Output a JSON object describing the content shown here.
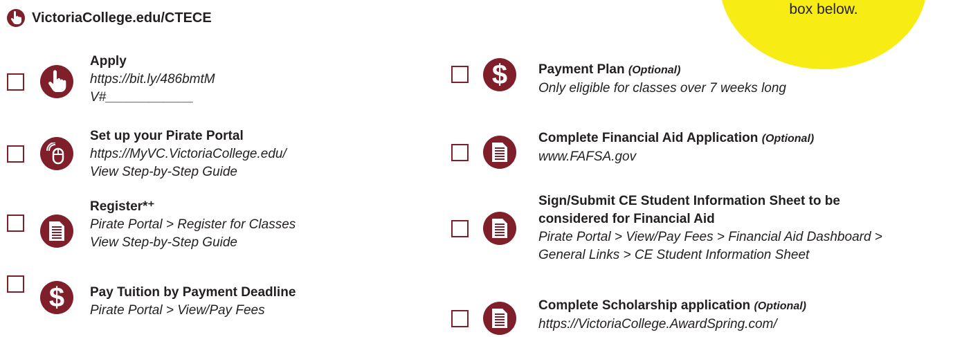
{
  "callout": {
    "text": "box below."
  },
  "site": {
    "url": "VictoriaCollege.edu/CTECE",
    "icon": "hand-pointer-icon"
  },
  "left_items": [
    {
      "title": "Apply",
      "lines": [
        "https://bit.ly/486bmtM",
        "V#____________"
      ],
      "icon": "hand-pointer-icon"
    },
    {
      "title": "Set up your Pirate Portal",
      "lines": [
        "https://MyVC.VictoriaCollege.edu/",
        "View Step-by-Step Guide"
      ],
      "icon": "mouse-icon"
    },
    {
      "title": "Register*⁺",
      "lines": [
        "Pirate Portal > Register for Classes",
        "View Step-by-Step Guide"
      ],
      "icon": "document-icon"
    },
    {
      "title": "Pay Tuition by Payment Deadline",
      "lines": [
        "Pirate Portal > View/Pay Fees"
      ],
      "icon": "dollar-icon"
    }
  ],
  "right_items": [
    {
      "title": "Payment Plan",
      "optional": "(Optional)",
      "lines": [
        "Only eligible for classes over 7 weeks long"
      ],
      "icon": "dollar-icon"
    },
    {
      "title": "Complete Financial Aid Application",
      "optional": "(Optional)",
      "lines": [
        "www.FAFSA.gov"
      ],
      "icon": "document-icon"
    },
    {
      "title": "Sign/Submit CE Student Information Sheet to be",
      "title2": "considered for Financial Aid",
      "lines": [
        "Pirate Portal > View/Pay Fees > Financial Aid Dashboard >",
        "General Links > CE Student Information Sheet"
      ],
      "icon": "document-icon"
    },
    {
      "title": "Complete Scholarship application",
      "optional": "(Optional)",
      "lines": [
        "https://VictoriaCollege.AwardSpring.com/"
      ],
      "icon": "document-icon"
    }
  ],
  "colors": {
    "accent": "#7e1f2a",
    "callout": "#f7ec13"
  }
}
